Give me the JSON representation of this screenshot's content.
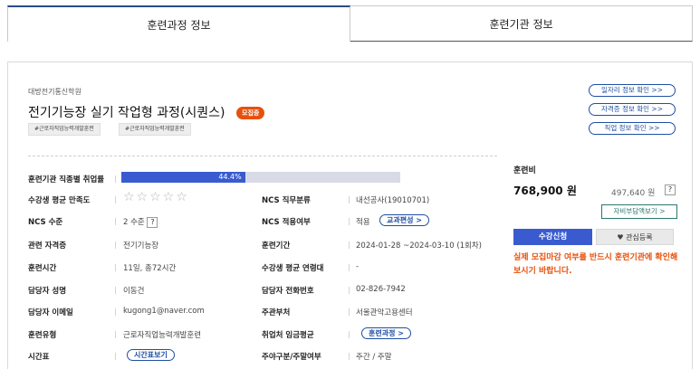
{
  "tabs": [
    {
      "label": "훈련과정 정보"
    },
    {
      "label": "훈련기관 정보"
    }
  ],
  "course": {
    "academy": "대방전기통신학원",
    "title": "전기기능장 실기 작업형 과정(시퀀스)",
    "badge": "모집중",
    "tags": [
      "#근로자직업능력개발훈련",
      "#근로자직업능력개발훈련"
    ]
  },
  "links": {
    "jobs": "일자리 정보 확인 >>",
    "license": "자격증 정보 확인 >>",
    "occupation": "직업 정보 확인 >>"
  },
  "employment": {
    "label": "훈련기관 직종별 취업률",
    "rate": 44.4,
    "rate_text": "44.4%"
  },
  "details": {
    "satisfaction_label": "수강생 평균 만족도",
    "stars": "☆☆☆☆☆",
    "ncs_job_label": "NCS 직무분류",
    "ncs_job_value": "내선공사(19010701)",
    "ncs_level_label": "NCS 수준",
    "ncs_level_value": "2 수준",
    "ncs_apply_label": "NCS 적용여부",
    "ncs_apply_value": "적용",
    "curriculum_pill": "교과편성 >",
    "license_label": "관련 자격증",
    "license_value": "전기기능장",
    "period_label": "훈련기간",
    "period_value": "2024-01-28 ~2024-03-10 (1회차)",
    "hours_label": "훈련시간",
    "hours_value": "11일, 총72시간",
    "age_label": "수강생 평균 연령대",
    "age_value": "-",
    "manager_label": "담당자 성명",
    "manager_value": "이동건",
    "phone_label": "담당자 전화번호",
    "phone_value": "02-826-7942",
    "email_label": "담당자 이메일",
    "email_value": "kugong1@naver.com",
    "dept_label": "주관부처",
    "dept_value": "서울관악고용센터",
    "type_label": "훈련유형",
    "type_value": "근로자직업능력개발훈련",
    "wage_label": "취업처 임금평균",
    "course_pill": "훈련과정 >",
    "timetable_label": "시간표",
    "timetable_pill": "시간표보기",
    "weekday_label": "주야구분/주말여부",
    "weekday_value": "주간 / 주말"
  },
  "pricing": {
    "label": "훈련비",
    "total": "768,900 원",
    "self_pay": "497,640 원",
    "help": "?",
    "self_button": "자비부담액보기 >",
    "apply_button": "수강신청",
    "favorite_button": "관심등록",
    "warning": "실제 모집마감 여부를 반드시 훈련기관에 확인해보시기 바랍니다."
  },
  "colors": {
    "accent": "#3a5bcf",
    "badge": "#e8500a",
    "link": "#1f4fa3"
  }
}
